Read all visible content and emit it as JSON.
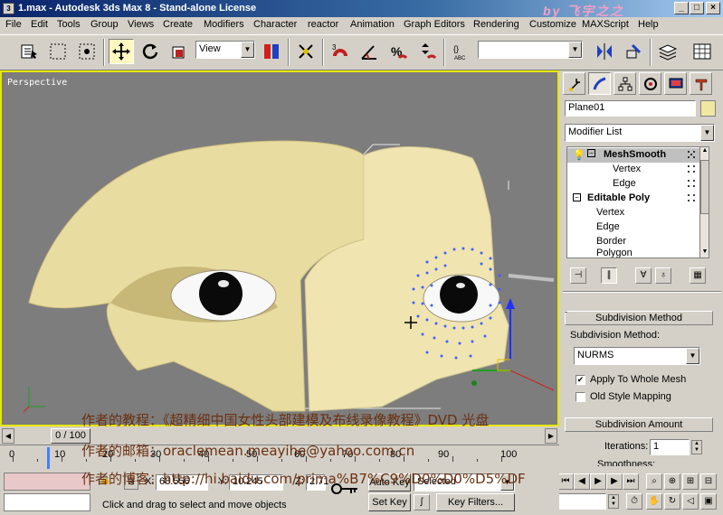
{
  "title": "1.max - Autodesk 3ds Max 8 - Stand-alone License",
  "window_buttons": [
    "_",
    "□",
    "×"
  ],
  "watermark": "by 飞宇之之",
  "menu": [
    "File",
    "Edit",
    "Tools",
    "Group",
    "Views",
    "Create",
    "Modifiers",
    "Character",
    "reactor",
    "Animation",
    "Graph Editors",
    "Rendering",
    "Customize",
    "MAXScript",
    "Help"
  ],
  "toolbar": {
    "view_dropdown": "View",
    "selection_set": "",
    "icons": [
      "select-and-link-icon",
      "select-icon",
      "select-region-icon",
      "window-crossing-icon",
      "select-move-icon",
      "select-rotate-icon",
      "select-scale-icon",
      "use-pivot-icon",
      "select-manipulate-icon",
      "snap-toggle-icon",
      "angle-snap-icon",
      "percent-snap-icon",
      "spinner-snap-icon",
      "edit-named-selection-icon",
      "mirror-icon",
      "align-icon",
      "layer-manager-icon",
      "curve-editor-icon"
    ]
  },
  "viewport": {
    "label": "Perspective",
    "border_color": "#e8e800",
    "background": "#7d7d7d",
    "skin_color": "#e8dca0"
  },
  "command_panel": {
    "tabs": [
      "create-tab",
      "modify-tab",
      "hierarchy-tab",
      "motion-tab",
      "display-tab",
      "utilities-tab"
    ],
    "object_name": "Plane01",
    "object_color": "#f0e8a0",
    "modifier_list": "Modifier List",
    "stack": [
      {
        "label": "MeshSmooth",
        "level": 0,
        "bold": true,
        "selected": true
      },
      {
        "label": "Vertex",
        "level": 1
      },
      {
        "label": "Edge",
        "level": 1
      },
      {
        "label": "Editable Poly",
        "level": 0,
        "bold": true
      },
      {
        "label": "Vertex",
        "level": 1
      },
      {
        "label": "Edge",
        "level": 1
      },
      {
        "label": "Border",
        "level": 1
      },
      {
        "label": "Polygon",
        "level": 1
      }
    ],
    "subdivision_method_title": "Subdivision Method",
    "subdivision_method_label": "Subdivision Method:",
    "subdivision_method_value": "NURMS",
    "apply_whole_mesh": "Apply To Whole Mesh",
    "apply_whole_mesh_checked": true,
    "old_style_mapping": "Old Style Mapping",
    "old_style_mapping_checked": false,
    "subdivision_amount_title": "Subdivision Amount",
    "iterations_label": "Iterations:",
    "iterations_value": "1",
    "smoothness_label": "Smoothness:"
  },
  "timeline": {
    "frame_indicator": "0 / 100",
    "ticks": [
      "0",
      "10",
      "20",
      "30",
      "40",
      "50",
      "60",
      "70",
      "80",
      "90",
      "100"
    ]
  },
  "status": {
    "x_label": "X:",
    "x_value": "68.556",
    "y_label": "Y:",
    "y_value": "10.245",
    "z_label": "Z:",
    "z_value": "2.71",
    "prompt": "Click and drag to select and move objects",
    "auto_key": "Auto Key",
    "set_key": "Set Key",
    "selected": "Selected",
    "key_filters": "Key Filters...",
    "frame": "0"
  },
  "overlay_text": [
    "作者的教程：《超精细中国女性头部建模及布线录像教程》DVD 光盘",
    "作者的邮箱：oraclemean.meayihe@yahoo.com.cn",
    "作者的博客：http://hi.baidu.com/prima%B7%C9%D0%D0%D5%DF"
  ]
}
